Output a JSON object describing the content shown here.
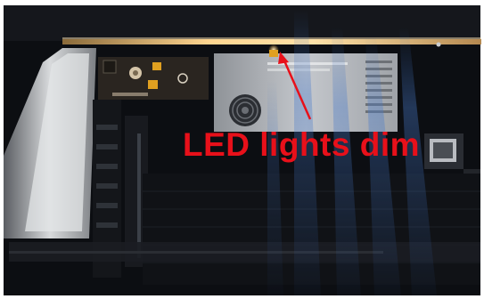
{
  "annotation": {
    "label": "LED lights dim",
    "color": "#e8101a"
  },
  "scene": {
    "frame_color": "#ffffff",
    "background_color": "#0c0e12",
    "led_strip_color": "#ffcf86",
    "power_supply_color": "#b9bcc1",
    "board_color": "#2a2520",
    "light_ray_color": "#3b6bb8"
  },
  "icons": [
    "cooling-fan-icon",
    "arrow-icon"
  ]
}
